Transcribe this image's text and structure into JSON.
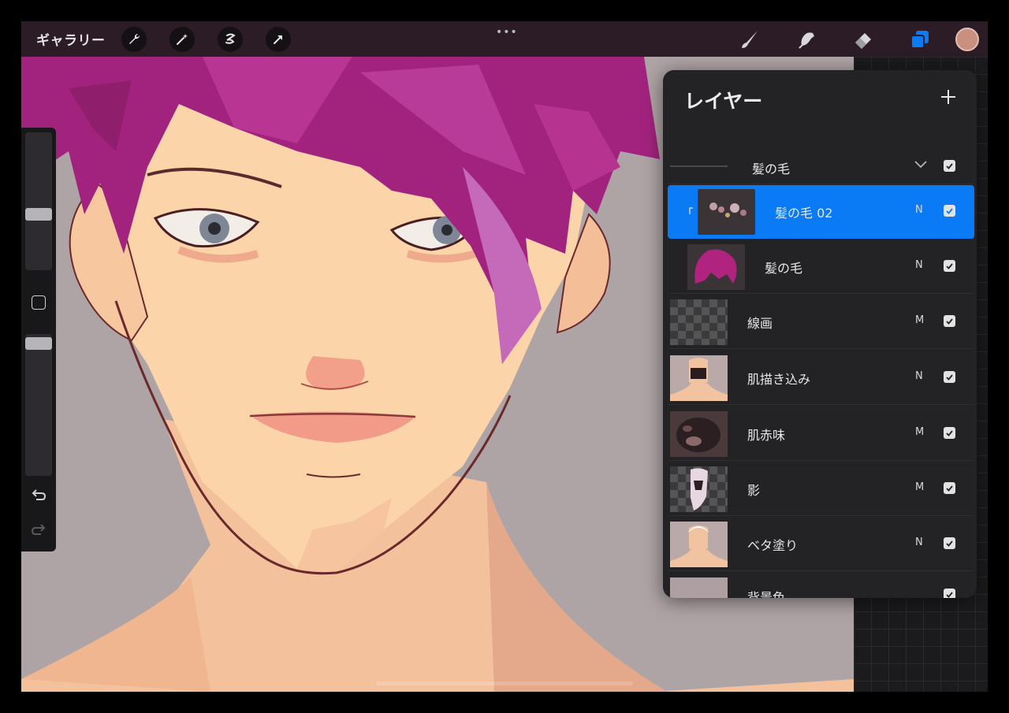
{
  "toolbar": {
    "gallery_label": "ギャラリー",
    "left_tools": [
      "wrench-icon",
      "magic-wand-icon",
      "selection-icon",
      "transform-arrow-icon"
    ],
    "more_label": "•••",
    "right_tools": [
      "brush-icon",
      "smudge-icon",
      "eraser-icon",
      "layers-icon"
    ],
    "active_color": "#c9907f",
    "accent": "#0a7af5"
  },
  "sidebar": {
    "brush_size_level": 0.42,
    "opacity_level": 0.97
  },
  "layers_panel": {
    "title": "レイヤー",
    "add_label": "+",
    "group": {
      "name": "髪の毛"
    },
    "layers": [
      {
        "name": "髪の毛 02",
        "mode": "N",
        "active": true
      },
      {
        "name": "髪の毛",
        "mode": "N",
        "active": false
      },
      {
        "name": "線画",
        "mode": "M",
        "active": false
      },
      {
        "name": "肌描き込み",
        "mode": "N",
        "active": false
      },
      {
        "name": "肌赤味",
        "mode": "M",
        "active": false
      },
      {
        "name": "影",
        "mode": "M",
        "active": false
      },
      {
        "name": "ベタ塗り",
        "mode": "N",
        "active": false
      },
      {
        "name": "背景色",
        "mode": "",
        "active": false
      }
    ]
  }
}
